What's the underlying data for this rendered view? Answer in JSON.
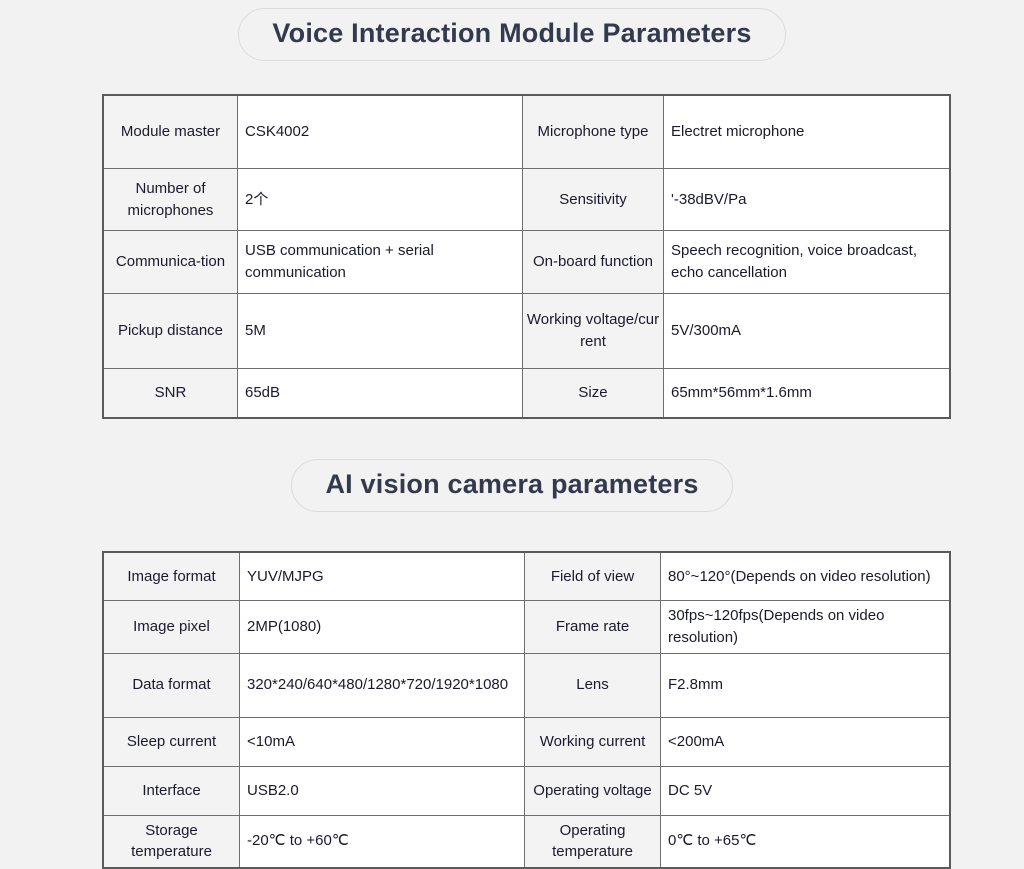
{
  "sections": [
    {
      "heading": "Voice Interaction Module Parameters",
      "table": {
        "rows": [
          {
            "label_left": "Module master",
            "value_left": "CSK4002",
            "label_right": "Microphone type",
            "value_right": "Electret microphone"
          },
          {
            "label_left": "Number of microphones",
            "value_left": "2个",
            "label_right": "Sensitivity",
            "value_right": "'-38dBV/Pa"
          },
          {
            "label_left": "Communica-tion",
            "value_left": "USB communication + serial communication",
            "label_right": "On-board function",
            "value_right": "Speech recognition, voice broadcast, echo cancellation"
          },
          {
            "label_left": "Pickup distance",
            "value_left": "5M",
            "label_right": "Working voltage/current",
            "value_right": "5V/300mA"
          },
          {
            "label_left": "SNR",
            "value_left": "65dB",
            "label_right": "Size",
            "value_right": "65mm*56mm*1.6mm"
          }
        ]
      }
    },
    {
      "heading": "AI vision camera parameters",
      "table": {
        "rows": [
          {
            "label_left": "Image format",
            "value_left": "YUV/MJPG",
            "label_right": "Field of view",
            "value_right": "80°~120°(Depends on video resolution)"
          },
          {
            "label_left": "Image pixel",
            "value_left": "2MP(1080)",
            "label_right": "Frame rate",
            "value_right": "30fps~120fps(Depends on video resolution)"
          },
          {
            "label_left": "Data format",
            "value_left": "320*240/640*480/1280*720/1920*1080",
            "label_right": "Lens",
            "value_right": "F2.8mm"
          },
          {
            "label_left": "Sleep current",
            "value_left": "<10mA",
            "label_right": "Working current",
            "value_right": "<200mA"
          },
          {
            "label_left": "Interface",
            "value_left": "USB2.0",
            "label_right": "Operating voltage",
            "value_right": "DC 5V"
          },
          {
            "label_left": "Storage temperature",
            "value_left": "-20℃ to +60℃",
            "label_right": "Operating temperature",
            "value_right": "0℃ to +65℃"
          }
        ]
      }
    }
  ],
  "colors": {
    "page_background": "#f2f2f2",
    "label_cell_background": "#f3f3f3",
    "value_cell_background": "#ffffff",
    "table_border": "#5a5a5a",
    "heading_text": "#333a4d",
    "body_text": "#1a1a2e"
  }
}
